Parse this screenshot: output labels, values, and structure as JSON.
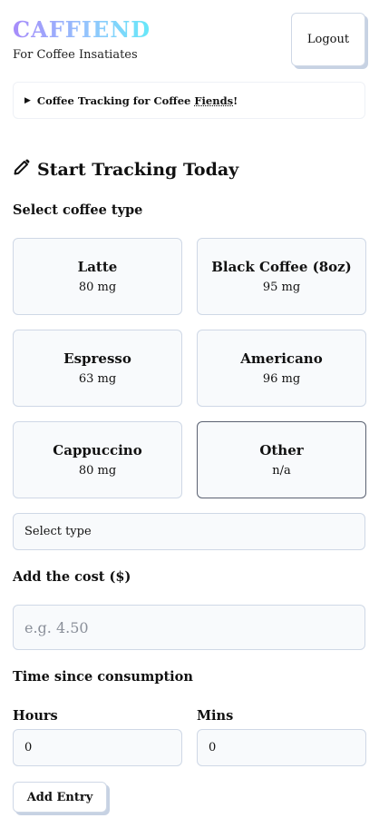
{
  "header": {
    "logo": "CAFFIEND",
    "tagline": "For Coffee Insatiates",
    "logout_label": "Logout"
  },
  "details": {
    "summary_prefix": "Coffee Tracking for Coffee ",
    "summary_emph": "Fiends",
    "summary_suffix": "!"
  },
  "form": {
    "title": "Start Tracking Today",
    "icon": "pencil-icon",
    "coffee_type_label": "Select coffee type",
    "coffee_types": [
      {
        "name": "Latte",
        "caffeine": "80 mg",
        "selected": false
      },
      {
        "name": "Black Coffee (8oz)",
        "caffeine": "95 mg",
        "selected": false
      },
      {
        "name": "Espresso",
        "caffeine": "63 mg",
        "selected": false
      },
      {
        "name": "Americano",
        "caffeine": "96 mg",
        "selected": false
      },
      {
        "name": "Cappuccino",
        "caffeine": "80 mg",
        "selected": false
      },
      {
        "name": "Other",
        "caffeine": "n/a",
        "selected": true
      }
    ],
    "select_type": "Select type",
    "cost_label": "Add the cost ($)",
    "cost_placeholder": "e.g. 4.50",
    "cost_value": "",
    "time_label": "Time since consumption",
    "hours_label": "Hours",
    "hours_value": "0",
    "mins_label": "Mins",
    "mins_value": "0",
    "add_entry_label": "Add Entry"
  },
  "colors": {
    "logo_gradient": [
      "#a78bfa",
      "#93c5fd",
      "#67e8f9"
    ],
    "card_border": "#cfd8e6",
    "card_background": "#f8fafc",
    "selected_border": "#5b6272"
  }
}
